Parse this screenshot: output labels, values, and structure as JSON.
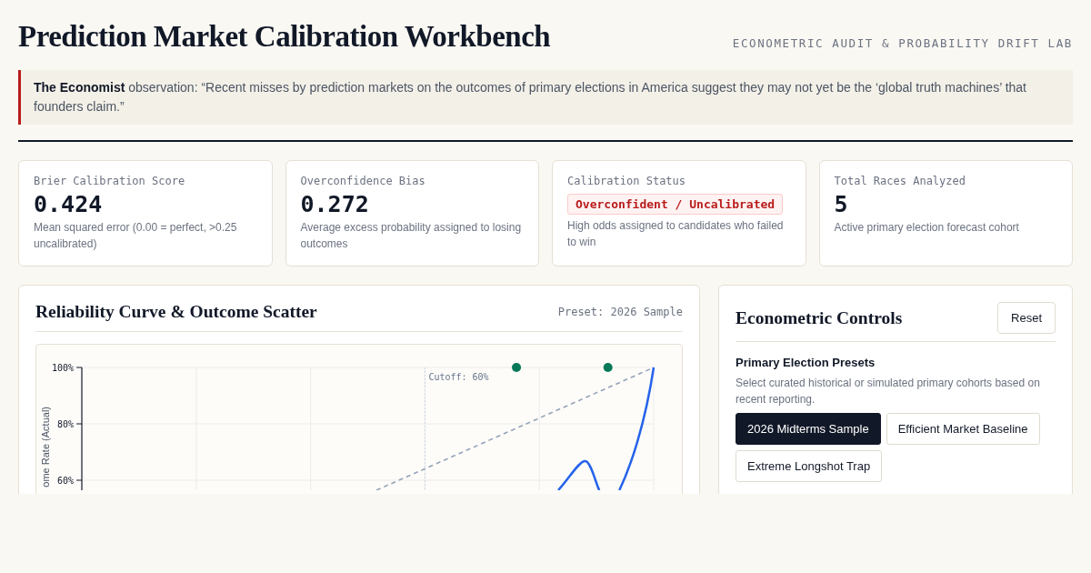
{
  "header": {
    "title": "Prediction Market Calibration Workbench",
    "subtitle": "ECONOMETRIC AUDIT & PROBABILITY DRIFT LAB"
  },
  "quote": "**The Economist** observation: “Recent misses by prediction markets on the outcomes of primary elections in America suggest they may not yet be the ‘global truth machines’ that founders claim.”",
  "metrics": [
    {
      "label": "Brier Calibration Score",
      "kind": "value",
      "value": "0.424",
      "description": "Mean squared error (0.00 = perfect, >0.25 uncalibrated)"
    },
    {
      "label": "Overconfidence Bias",
      "kind": "value",
      "value": "0.272",
      "description": "Average excess probability assigned to losing outcomes"
    },
    {
      "label": "Calibration Status",
      "kind": "status",
      "value": "Overconfident / Uncalibrated",
      "description": "High odds assigned to candidates who failed to win"
    },
    {
      "label": "Total Races Analyzed",
      "kind": "value",
      "value": "5",
      "description": "Active primary election forecast cohort"
    }
  ],
  "chart_panel": {
    "title": "Reliability Curve & Outcome Scatter",
    "preset": "Preset: 2026 Sample",
    "chart": {
      "kind": "picture",
      "y_axis_title": "ome Rate (Actual)",
      "y_tick_labels": [
        "100%",
        "80%",
        "60%"
      ],
      "cutoff_label": "Cutoff: 60%"
    }
  },
  "controls": {
    "title": "Econometric Controls",
    "reset": "Reset",
    "section_title": "Primary Election Presets",
    "section_description": "Select curated historical or simulated primary cohorts based on recent reporting.",
    "presets": [
      {
        "label": "2026 Midterms Sample",
        "selected": true
      },
      {
        "label": "Efficient Market Baseline",
        "selected": false
      },
      {
        "label": "Extreme Longshot Trap",
        "selected": false
      }
    ]
  }
}
